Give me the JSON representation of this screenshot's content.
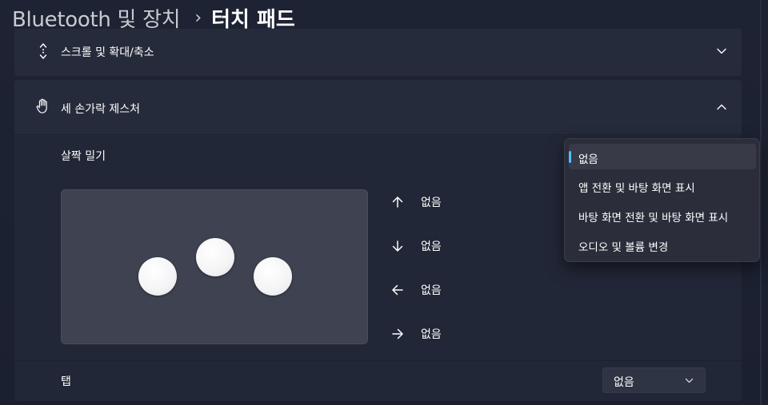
{
  "breadcrumb": {
    "parent": "Bluetooth 및 장치",
    "separator": "›",
    "current": "터치 패드"
  },
  "sections": {
    "scroll_zoom": {
      "label": "스크롤 및 확대/축소",
      "icon": "scroll-arrows-icon",
      "expanded": false
    },
    "three_finger": {
      "label": "세 손가락 제스처",
      "icon": "hand-icon",
      "expanded": true
    }
  },
  "swipe": {
    "title": "살짝 밀기",
    "directions": [
      {
        "icon": "arrow-up-icon",
        "label": "없음"
      },
      {
        "icon": "arrow-down-icon",
        "label": "없음"
      },
      {
        "icon": "arrow-left-icon",
        "label": "없음"
      },
      {
        "icon": "arrow-right-icon",
        "label": "없음"
      }
    ]
  },
  "tap": {
    "label": "탭",
    "value": "없음"
  },
  "dropdown": {
    "options": [
      "없음",
      "앱 전환 및 바탕 화면 표시",
      "바탕 화면 전환 및 바탕 화면 표시",
      "오디오 및 볼륨 변경"
    ],
    "selected_index": 0
  },
  "colors": {
    "accent": "#4cc2ff",
    "background": "#1e2333",
    "card": "#262b3b"
  }
}
